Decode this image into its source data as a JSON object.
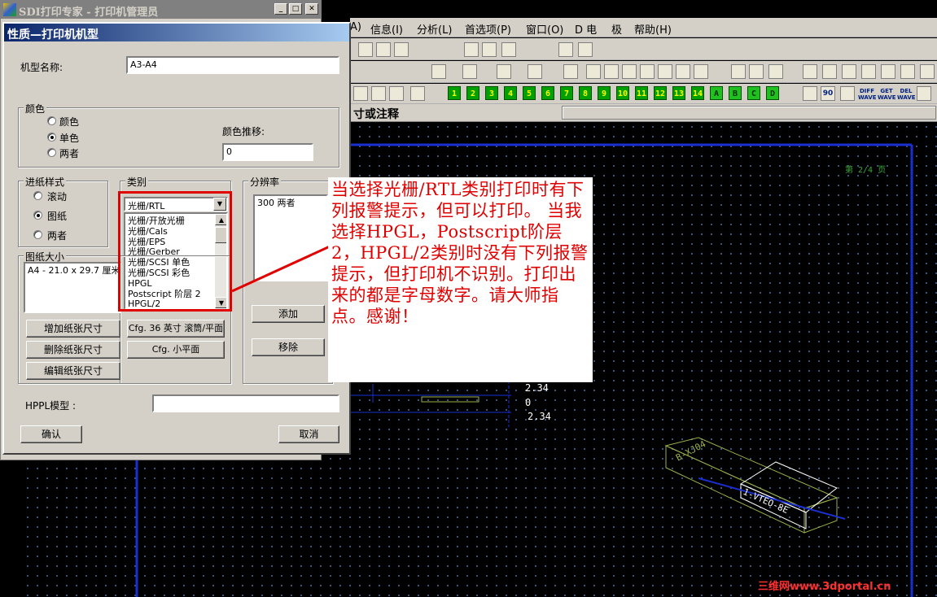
{
  "parent_window": {
    "title": "SDI打印专家 - 打印机管理员",
    "controls": {
      "minimize": "_",
      "maximize": "□",
      "close": "✕"
    }
  },
  "menubar": {
    "items": [
      "A)",
      "信息(I)",
      "分析(L)",
      "首选项(P)",
      "窗口(O)",
      "D 电",
      "极",
      "帮助(H)"
    ]
  },
  "toolbar_numbers": [
    "1",
    "2",
    "3",
    "4",
    "5",
    "6",
    "7",
    "8",
    "9",
    "10",
    "11",
    "12",
    "13",
    "14",
    "A",
    "B",
    "C",
    "D"
  ],
  "toolbar_text_buttons": [
    "DIFF WAVE",
    "GET WAVE",
    "DEL WAVE"
  ],
  "title_strip_text": "寸或注释",
  "dialog": {
    "title": "性质—打印机机型",
    "model_name_label": "机型名称:",
    "model_name_value": "A3-A4",
    "color_group": {
      "title": "颜色",
      "options": [
        "颜色",
        "单色",
        "两者"
      ],
      "selected": "单色",
      "shift_label": "颜色推移:",
      "shift_value": "0"
    },
    "feed_group": {
      "title": "进纸样式",
      "options": [
        "滚动",
        "图纸",
        "两者"
      ],
      "selected": "图纸"
    },
    "category_group": {
      "title": "类别",
      "selected": "光栅/RTL",
      "list": [
        "光栅/开放光栅",
        "光栅/Cals",
        "光栅/EPS",
        "光栅/Gerber",
        "光栅/SCSI 单色",
        "光栅/SCSI 彩色",
        "HPGL",
        "Postscript 阶层 2",
        "HPGL/2"
      ]
    },
    "resolution_group": {
      "title": "分辨率",
      "items": [
        "300 两者"
      ],
      "add_button": "添加",
      "remove_button": "移除"
    },
    "paper_group": {
      "title": "图纸大小",
      "items": [
        "A4 - 21.0 x 29.7 厘米"
      ]
    },
    "buttons": {
      "add_paper": "增加纸张尺寸",
      "delete_paper": "删除纸张尺寸",
      "edit_paper": "编辑纸张尺寸",
      "cfg36": "Cfg. 36 英寸 滚筒/平面",
      "cfg_small": "Cfg. 小平面",
      "ok": "确认",
      "cancel": "取消"
    },
    "hppl_label": "HPPL模型 :",
    "hppl_value": ""
  },
  "annotation": {
    "text": "当选择光栅/RTL类别打印时有下列报警提示，但可以打印。 当我选择HPGL，Postscript阶层2，HPGL/2类别时没有下列报警提示，但打印机不识别。打印出来的都是字母数字。请大师指点。感谢！"
  },
  "cad": {
    "page_label": "第 2/4 页",
    "dims": [
      "2.34",
      "0",
      "2.34"
    ],
    "part_label": "B-XJ04",
    "part_label2": "1-VTEO-8E"
  },
  "watermark": "三维网www.3dportal.cn",
  "colors": {
    "accent_red": "#e00000",
    "title_blue": "#0a246a",
    "grid_blue": "#1a2fd0"
  }
}
